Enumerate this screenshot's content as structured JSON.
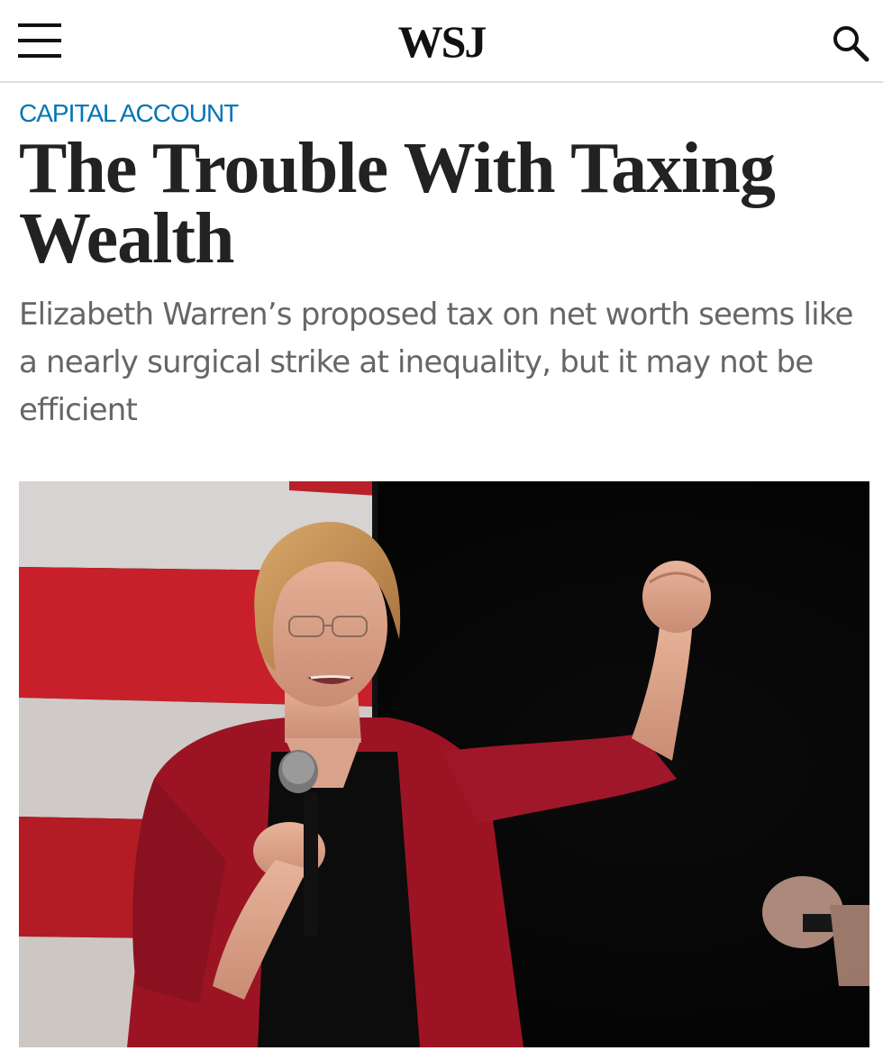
{
  "header": {
    "logo": "WSJ",
    "menu_icon": "hamburger-menu-icon",
    "search_icon": "search-icon"
  },
  "article": {
    "kicker": "CAPITAL ACCOUNT",
    "headline": "The Trouble With Taxing Wealth",
    "dek": "Elizabeth Warren’s proposed tax on net worth seems like a nearly surgical strike at inequality, but it may not be efficient"
  },
  "colors": {
    "kicker": "#0274b6",
    "headline": "#222222",
    "dek": "#666666",
    "divider": "#d9e0e3"
  }
}
